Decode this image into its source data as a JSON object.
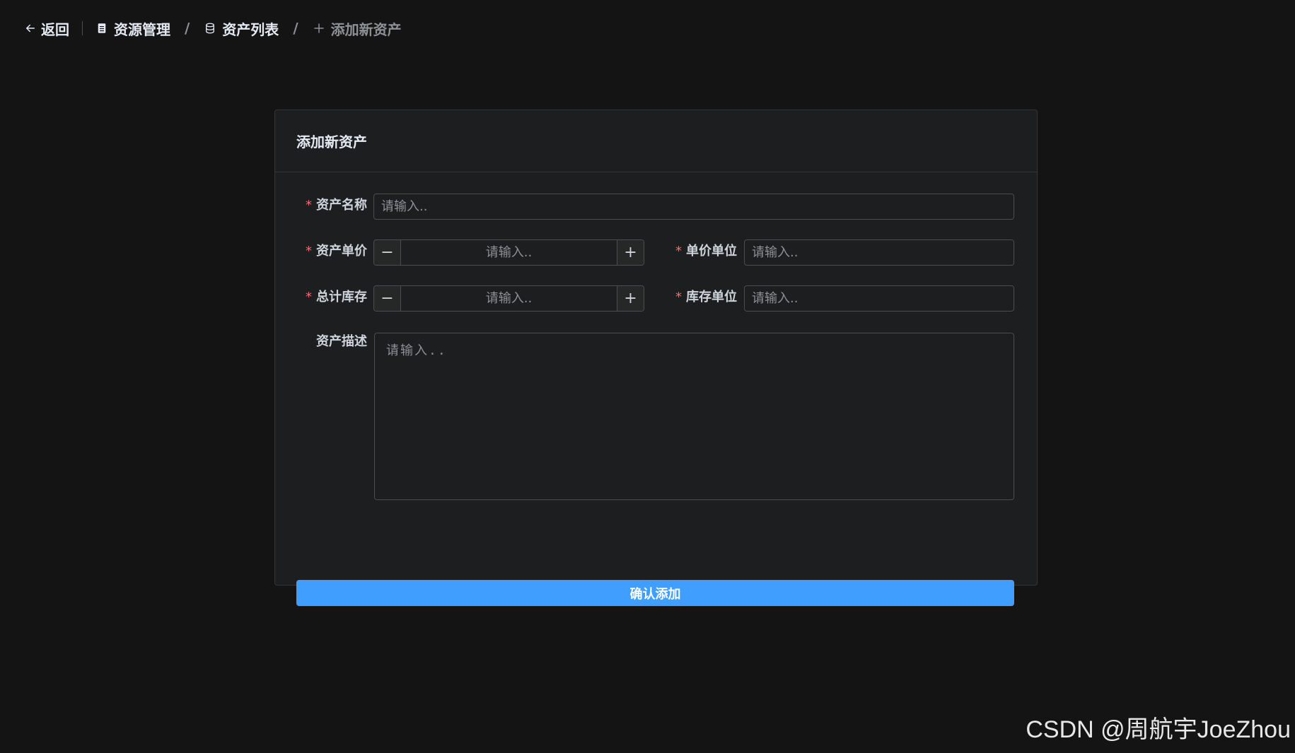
{
  "breadcrumb": {
    "back_label": "返回",
    "items": [
      {
        "label": "资源管理",
        "icon": "document-icon"
      },
      {
        "label": "资产列表",
        "icon": "database-icon"
      },
      {
        "label": "添加新资产",
        "icon": "plus-icon"
      }
    ],
    "separator": "/"
  },
  "form": {
    "title": "添加新资产",
    "required_mark": "*",
    "fields": {
      "name": {
        "label": "资产名称",
        "placeholder": "请输入.."
      },
      "price": {
        "label": "资产单价",
        "placeholder": "请输入..",
        "minus": "−",
        "plus": "+"
      },
      "price_unit": {
        "label": "单价单位",
        "placeholder": "请输入.."
      },
      "stock": {
        "label": "总计库存",
        "placeholder": "请输入..",
        "minus": "−",
        "plus": "+"
      },
      "stock_unit": {
        "label": "库存单位",
        "placeholder": "请输入.."
      },
      "description": {
        "label": "资产描述",
        "placeholder": "请输入.."
      }
    },
    "submit_label": "确认添加"
  },
  "watermark": "CSDN @周航宇JoeZhou",
  "colors": {
    "background": "#141414",
    "card": "#1d1e1f",
    "primary": "#409eff",
    "required": "#f56c6c"
  }
}
